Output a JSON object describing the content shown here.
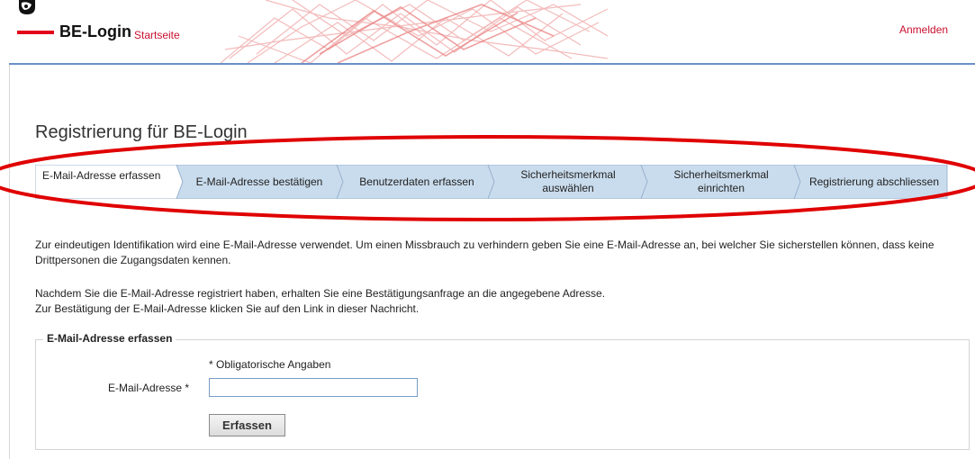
{
  "header": {
    "logo_text": "BE-Login",
    "home_link": "Startseite",
    "login_link": "Anmelden",
    "accent_color": "#e2001a",
    "link_color": "#c8102e",
    "line_color": "#6a8fc7"
  },
  "page_title": "Registrierung für BE-Login",
  "steps": [
    {
      "label": "E-Mail-Adresse erfassen",
      "active": true
    },
    {
      "label": "E-Mail-Adresse bestätigen",
      "active": false
    },
    {
      "label": "Benutzerdaten erfassen",
      "active": false
    },
    {
      "label": "Sicherheitsmerkmal auswählen",
      "active": false
    },
    {
      "label": "Sicherheitsmerkmal einrichten",
      "active": false
    },
    {
      "label": "Registrierung abschliessen",
      "active": false
    }
  ],
  "step_colors": {
    "active": "#ffffff",
    "inactive": "#c9dced"
  },
  "intro": {
    "p1": "Zur eindeutigen Identifikation wird eine E-Mail-Adresse verwendet. Um einen Missbrauch zu verhindern geben Sie eine E-Mail-Adresse an, bei welcher Sie sicherstellen können, dass keine Drittpersonen die Zugangsdaten kennen.",
    "p2_line1": "Nachdem Sie die E-Mail-Adresse registriert haben, erhalten Sie eine Bestätigungsanfrage an die angegebene Adresse.",
    "p2_line2": "Zur Bestätigung der E-Mail-Adresse klicken Sie auf den Link in dieser Nachricht."
  },
  "form": {
    "legend": "E-Mail-Adresse erfassen",
    "required_note": "* Obligatorische Angaben",
    "email_label": "E-Mail-Adresse *",
    "email_value": "",
    "submit_label": "Erfassen"
  }
}
